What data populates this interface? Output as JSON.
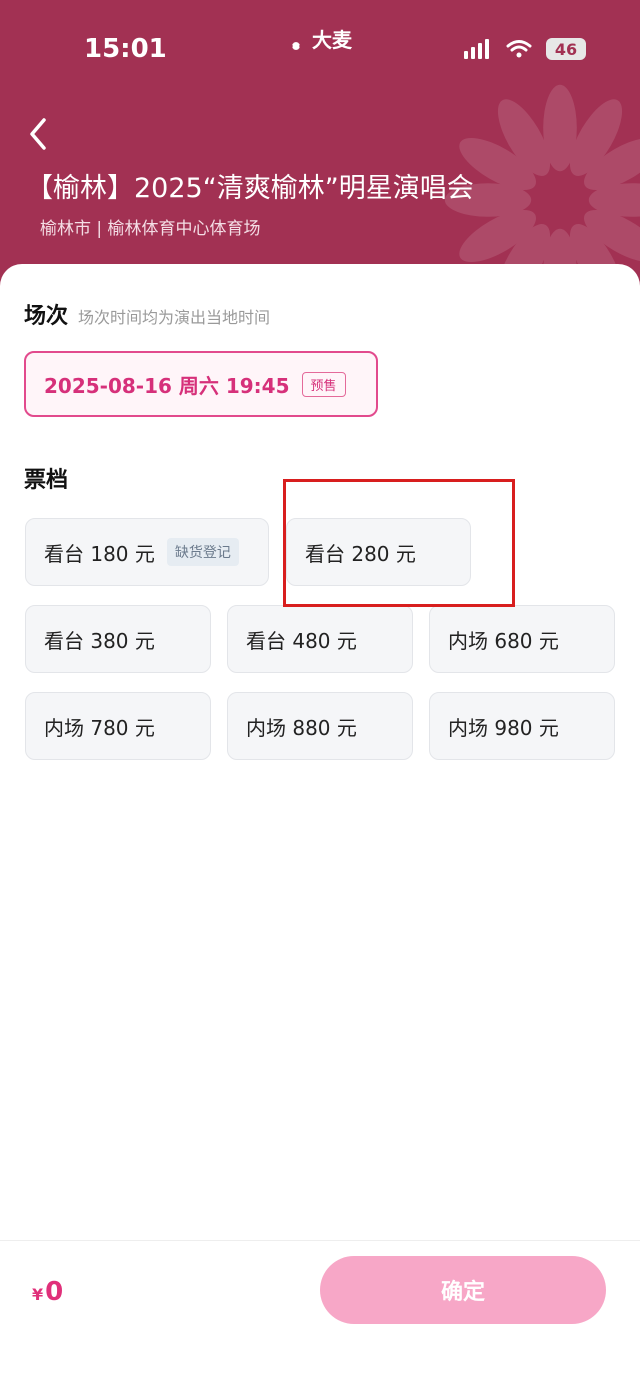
{
  "status_bar": {
    "time": "15:01",
    "brand": "大麦",
    "battery": "46"
  },
  "event": {
    "title": "【榆林】2025“清爽榆林”明星演唱会",
    "venue": "榆林市 | 榆林体育中心体育场"
  },
  "session": {
    "label": "场次",
    "note": "场次时间均为演出当地时间",
    "date": "2025-08-16 周六 19:45",
    "status": "预售"
  },
  "tiers": {
    "label": "票档",
    "items": [
      {
        "label": "看台 180 元",
        "tag": "缺货登记"
      },
      {
        "label": "看台 280 元"
      },
      {
        "label": "看台 380 元"
      },
      {
        "label": "看台 480 元"
      },
      {
        "label": "内场 680 元"
      },
      {
        "label": "内场 780 元"
      },
      {
        "label": "内场 880 元"
      },
      {
        "label": "内场 980 元"
      }
    ]
  },
  "footer": {
    "currency": "¥",
    "total": "0",
    "confirm": "确定"
  },
  "colors": {
    "header": "#a23153",
    "accent": "#e0307a",
    "highlight": "#d81e1e",
    "confirm_disabled": "#f7a7c7"
  },
  "icons": {
    "back": "chevron-left-icon",
    "brand": "damai-logo-icon",
    "signal": "signal-icon",
    "wifi": "wifi-icon",
    "battery": "battery-icon"
  }
}
